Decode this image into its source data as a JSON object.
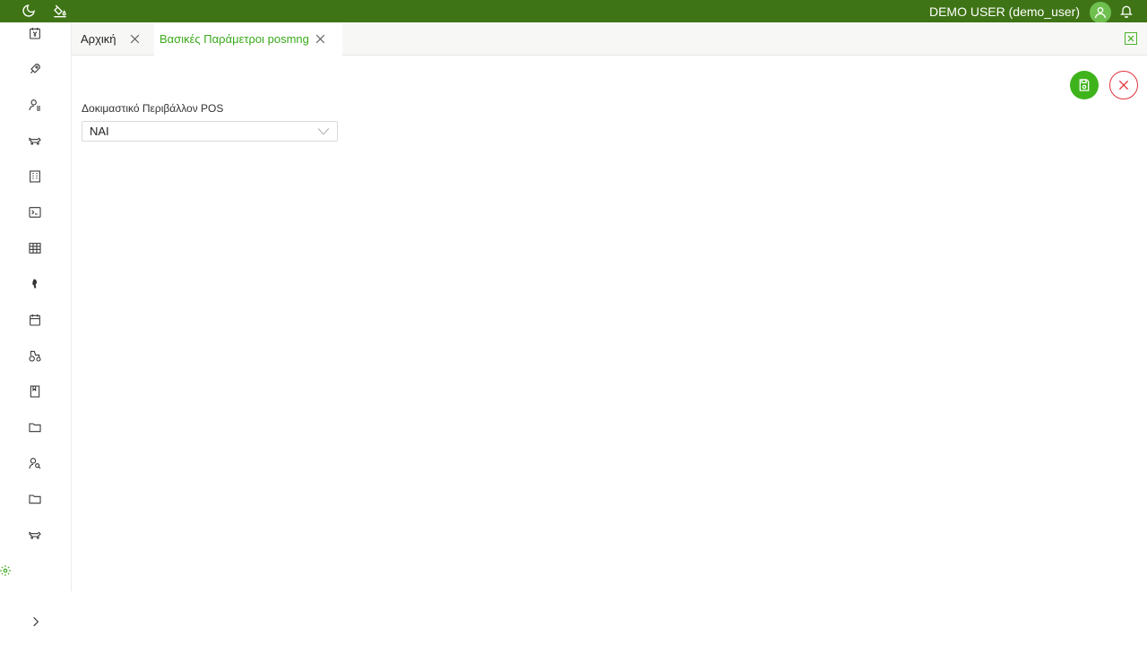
{
  "topbar": {
    "icons": [
      "moon-icon",
      "paint-bucket-icon",
      "user-avatar-icon",
      "bell-icon"
    ],
    "user_display": "DEMO USER (demo_user)",
    "color": "#3f7416"
  },
  "sidebar": {
    "icons": [
      "calendar-yen-icon",
      "rocket-icon",
      "user-list-icon",
      "cow-icon",
      "building-icon",
      "terminal-icon",
      "table-grid-icon",
      "bird-icon",
      "calendar-icon",
      "tractor-icon",
      "book-icon",
      "folder-icon",
      "user-search-icon",
      "folder-icon",
      "cow-icon"
    ],
    "settings_icon": "gear-icon",
    "collapse_icon": "chevron-right-icon"
  },
  "tabs": [
    {
      "label": "Αρχική",
      "active": false
    },
    {
      "label": "Βασικές Παράμετροι posmng",
      "active": true
    }
  ],
  "accent_color": "#3aa91a",
  "danger_color": "#e0333c",
  "form": {
    "field_label": "Δοκιμαστικό Περιβάλλον POS",
    "selected_value": "ΝΑΙ"
  }
}
